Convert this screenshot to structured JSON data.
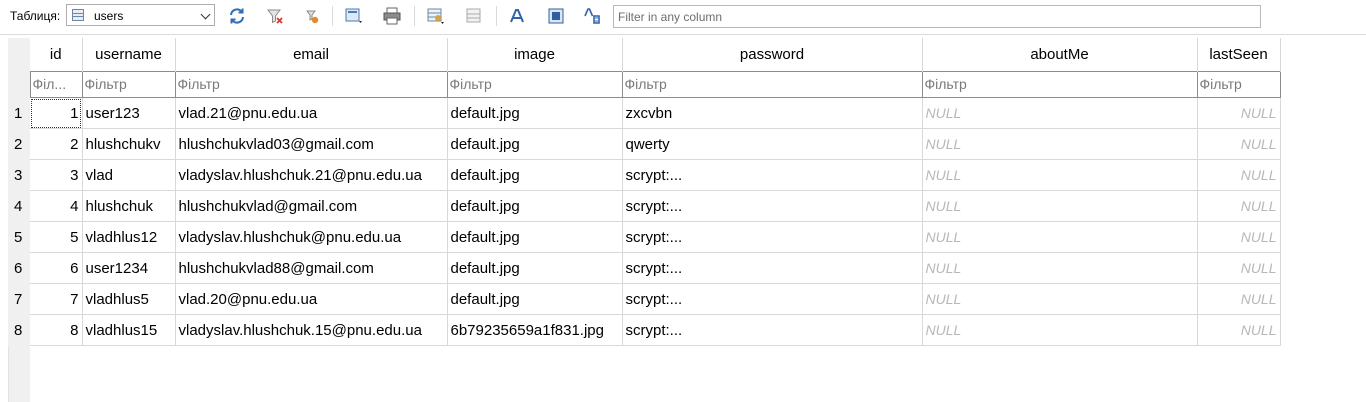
{
  "toolbar": {
    "table_label": "Таблиця:",
    "table_select_value": "users",
    "filter_placeholder": "Filter in any column",
    "buttons": [
      {
        "name": "refresh-icon"
      },
      {
        "name": "clear-filters-icon"
      },
      {
        "name": "save-filter-icon"
      },
      {
        "name": "print-icon"
      },
      {
        "name": "insert-record-icon"
      },
      {
        "name": "delete-record-icon"
      },
      {
        "name": "font-icon"
      },
      {
        "name": "hex-icon"
      },
      {
        "name": "text-format-icon"
      }
    ]
  },
  "grid": {
    "columns": [
      "id",
      "username",
      "email",
      "image",
      "password",
      "aboutMe",
      "lastSeen"
    ],
    "filter_placeholders": [
      "Філ...",
      "Фільтр",
      "Фільтр",
      "Фільтр",
      "Фільтр",
      "Фільтр",
      "Фільтр"
    ],
    "rows": [
      {
        "row": "1",
        "id": "1",
        "username": "user123",
        "email": "vlad.21@pnu.edu.ua",
        "image": "default.jpg",
        "password": "zxcvbn",
        "aboutMe": "NULL",
        "lastSeen": "NULL"
      },
      {
        "row": "2",
        "id": "2",
        "username": "hlushchukv",
        "email": "hlushchukvlad03@gmail.com",
        "image": "default.jpg",
        "password": "qwerty",
        "aboutMe": "NULL",
        "lastSeen": "NULL"
      },
      {
        "row": "3",
        "id": "3",
        "username": "vlad",
        "email": "vladyslav.hlushchuk.21@pnu.edu.ua",
        "image": "default.jpg",
        "password": "scrypt:...",
        "aboutMe": "NULL",
        "lastSeen": "NULL"
      },
      {
        "row": "4",
        "id": "4",
        "username": "hlushchuk",
        "email": "hlushchukvlad@gmail.com",
        "image": "default.jpg",
        "password": "scrypt:...",
        "aboutMe": "NULL",
        "lastSeen": "NULL"
      },
      {
        "row": "5",
        "id": "5",
        "username": "vladhlus12",
        "email": "vladyslav.hlushchuk@pnu.edu.ua",
        "image": "default.jpg",
        "password": "scrypt:...",
        "aboutMe": "NULL",
        "lastSeen": "NULL"
      },
      {
        "row": "6",
        "id": "6",
        "username": "user1234",
        "email": "hlushchukvlad88@gmail.com",
        "image": "default.jpg",
        "password": "scrypt:...",
        "aboutMe": "NULL",
        "lastSeen": "NULL"
      },
      {
        "row": "7",
        "id": "7",
        "username": "vladhlus5",
        "email": "vlad.20@pnu.edu.ua",
        "image": "default.jpg",
        "password": "scrypt:...",
        "aboutMe": "NULL",
        "lastSeen": "NULL"
      },
      {
        "row": "8",
        "id": "8",
        "username": "vladhlus15",
        "email": "vladyslav.hlushchuk.15@pnu.edu.ua",
        "image": "6b79235659a1f831.jpg",
        "password": "scrypt:...",
        "aboutMe": "NULL",
        "lastSeen": "NULL"
      }
    ]
  },
  "colors": {
    "gutter": "#f0f0f0",
    "null_text": "#b8b8b8",
    "filter_text": "#7a7a7a"
  }
}
